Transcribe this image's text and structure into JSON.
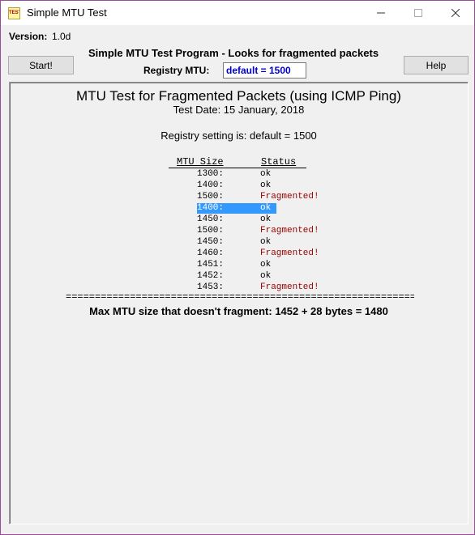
{
  "window": {
    "title": "Simple MTU Test",
    "icon": "app-icon",
    "icon_text": "TEST"
  },
  "header": {
    "version_label": "Version:",
    "version_value": "1.0d",
    "program_title": "Simple MTU Test Program - Looks for fragmented packets",
    "registry_label": "Registry MTU:",
    "registry_value": "default = 1500",
    "start_button": "Start!",
    "help_button": "Help"
  },
  "report": {
    "title": "MTU Test for Fragmented Packets (using ICMP Ping)",
    "date": "Test Date: 15 January, 2018",
    "registry": "Registry setting is: default = 1500",
    "columns": [
      "MTU Size",
      "Status"
    ],
    "rows": [
      {
        "size": "1300:",
        "status": "ok"
      },
      {
        "size": "1400:",
        "status": "ok"
      },
      {
        "size": "1500:",
        "status": "Fragmented!"
      },
      {
        "size": "1400:",
        "status": "ok"
      },
      {
        "size": "1450:",
        "status": "ok"
      },
      {
        "size": "1500:",
        "status": "Fragmented!"
      },
      {
        "size": "1450:",
        "status": "ok"
      },
      {
        "size": "1460:",
        "status": "Fragmented!"
      },
      {
        "size": "1451:",
        "status": "ok"
      },
      {
        "size": "1452:",
        "status": "ok"
      },
      {
        "size": "1453:",
        "status": "Fragmented!"
      }
    ],
    "selected_row": 3,
    "separator": "================================================================",
    "result": "Max MTU size that doesn't fragment: 1452 + 28 bytes = 1480"
  },
  "colors": {
    "fragmented": "#990000",
    "selection": "#3399ff",
    "registry_value": "#0000cc",
    "border": "#9b4a9b"
  }
}
